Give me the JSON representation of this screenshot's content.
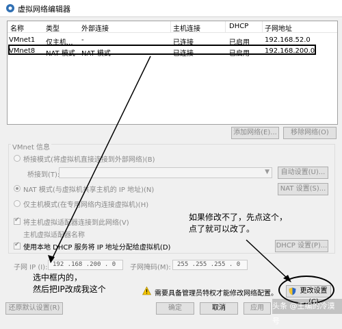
{
  "window": {
    "title": "虚拟网络编辑器"
  },
  "table": {
    "headers": [
      "名称",
      "类型",
      "外部连接",
      "主机连接",
      "DHCP",
      "子网地址"
    ],
    "rows": [
      [
        "VMnet1",
        "仅主机...",
        "-",
        "已连接",
        "已启用",
        "192.168.52.0"
      ],
      [
        "VMnet8",
        "NAT 模式",
        "NAT 模式",
        "已连接",
        "已启用",
        "192.168.200.0"
      ]
    ]
  },
  "list_buttons": {
    "add_network": "添加网络(E)...",
    "remove_network": "移除网络(O)"
  },
  "vmnet_info": {
    "group_label": "VMnet 信息",
    "bridged_label": "桥接模式(将虚拟机直接连接到外部网络)(B)",
    "bridged_to_label": "桥接到(T):",
    "auto_settings": "自动设置(U)...",
    "nat_label": "NAT 模式(与虚拟机共享主机的 IP 地址)(N)",
    "nat_settings": "NAT 设置(S)...",
    "hostonly_label": "仅主机模式(在专用网络内连接虚拟机)(H)",
    "connect_adapter": "将主机虚拟适配器连接到此网络(V)",
    "adapter_name": "主机虚拟适配器名称",
    "use_dhcp": "使用本地 DHCP 服务将 IP 地址分配给虚拟机(D)",
    "dhcp_settings": "DHCP 设置(P)...",
    "subnet_ip_label": "子网 IP (I):",
    "subnet_ip_value": "192 .168 .200 . 0",
    "subnet_mask_label": "子网掩码(M):",
    "subnet_mask_value": "255 .255 .255 . 0"
  },
  "annotations": {
    "right_note_line1": "如果修改不了，先点这个，",
    "right_note_line2": "点了就可以改了。",
    "left_note_line1": "选中框内的，",
    "left_note_line2": "然后把IP改成我这个"
  },
  "footer": {
    "admin_note": "需要具备管理员特权才能修改网络配置。",
    "change_settings": "更改设置(C)",
    "restore_defaults": "还原默认设置(R)",
    "ok": "确定",
    "cancel": "取消",
    "apply": "应用",
    "watermark": "头条 @王编的冷漠号"
  }
}
